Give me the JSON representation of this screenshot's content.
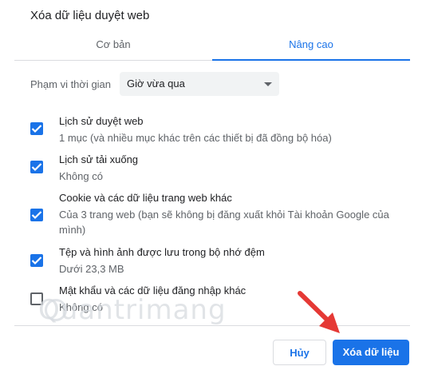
{
  "dialog": {
    "title": "Xóa dữ liệu duyệt web"
  },
  "tabs": [
    {
      "label": "Cơ bản",
      "selected": false
    },
    {
      "label": "Nâng cao",
      "selected": true
    }
  ],
  "time_range": {
    "label": "Phạm vi thời gian",
    "value": "Giờ vừa qua"
  },
  "items": [
    {
      "title": "Lịch sử duyệt web",
      "subtitle": "1 mục (và nhiều mục khác trên các thiết bị đã đồng bộ hóa)",
      "checked": true
    },
    {
      "title": "Lịch sử tải xuống",
      "subtitle": "Không có",
      "checked": true
    },
    {
      "title": "Cookie và các dữ liệu trang web khác",
      "subtitle": "Của 3 trang web (bạn sẽ không bị đăng xuất khỏi Tài khoản Google của mình)",
      "checked": true
    },
    {
      "title": "Tệp và hình ảnh được lưu trong bộ nhớ đệm",
      "subtitle": "Dưới 23,3 MB",
      "checked": true
    },
    {
      "title": "Mật khẩu và các dữ liệu đăng nhập khác",
      "subtitle": "Không có",
      "checked": false
    }
  ],
  "watermark": "Quantrimang",
  "buttons": {
    "cancel": "Hủy",
    "clear": "Xóa dữ liệu"
  },
  "colors": {
    "accent": "#1a73e8",
    "arrow": "#e53935"
  }
}
